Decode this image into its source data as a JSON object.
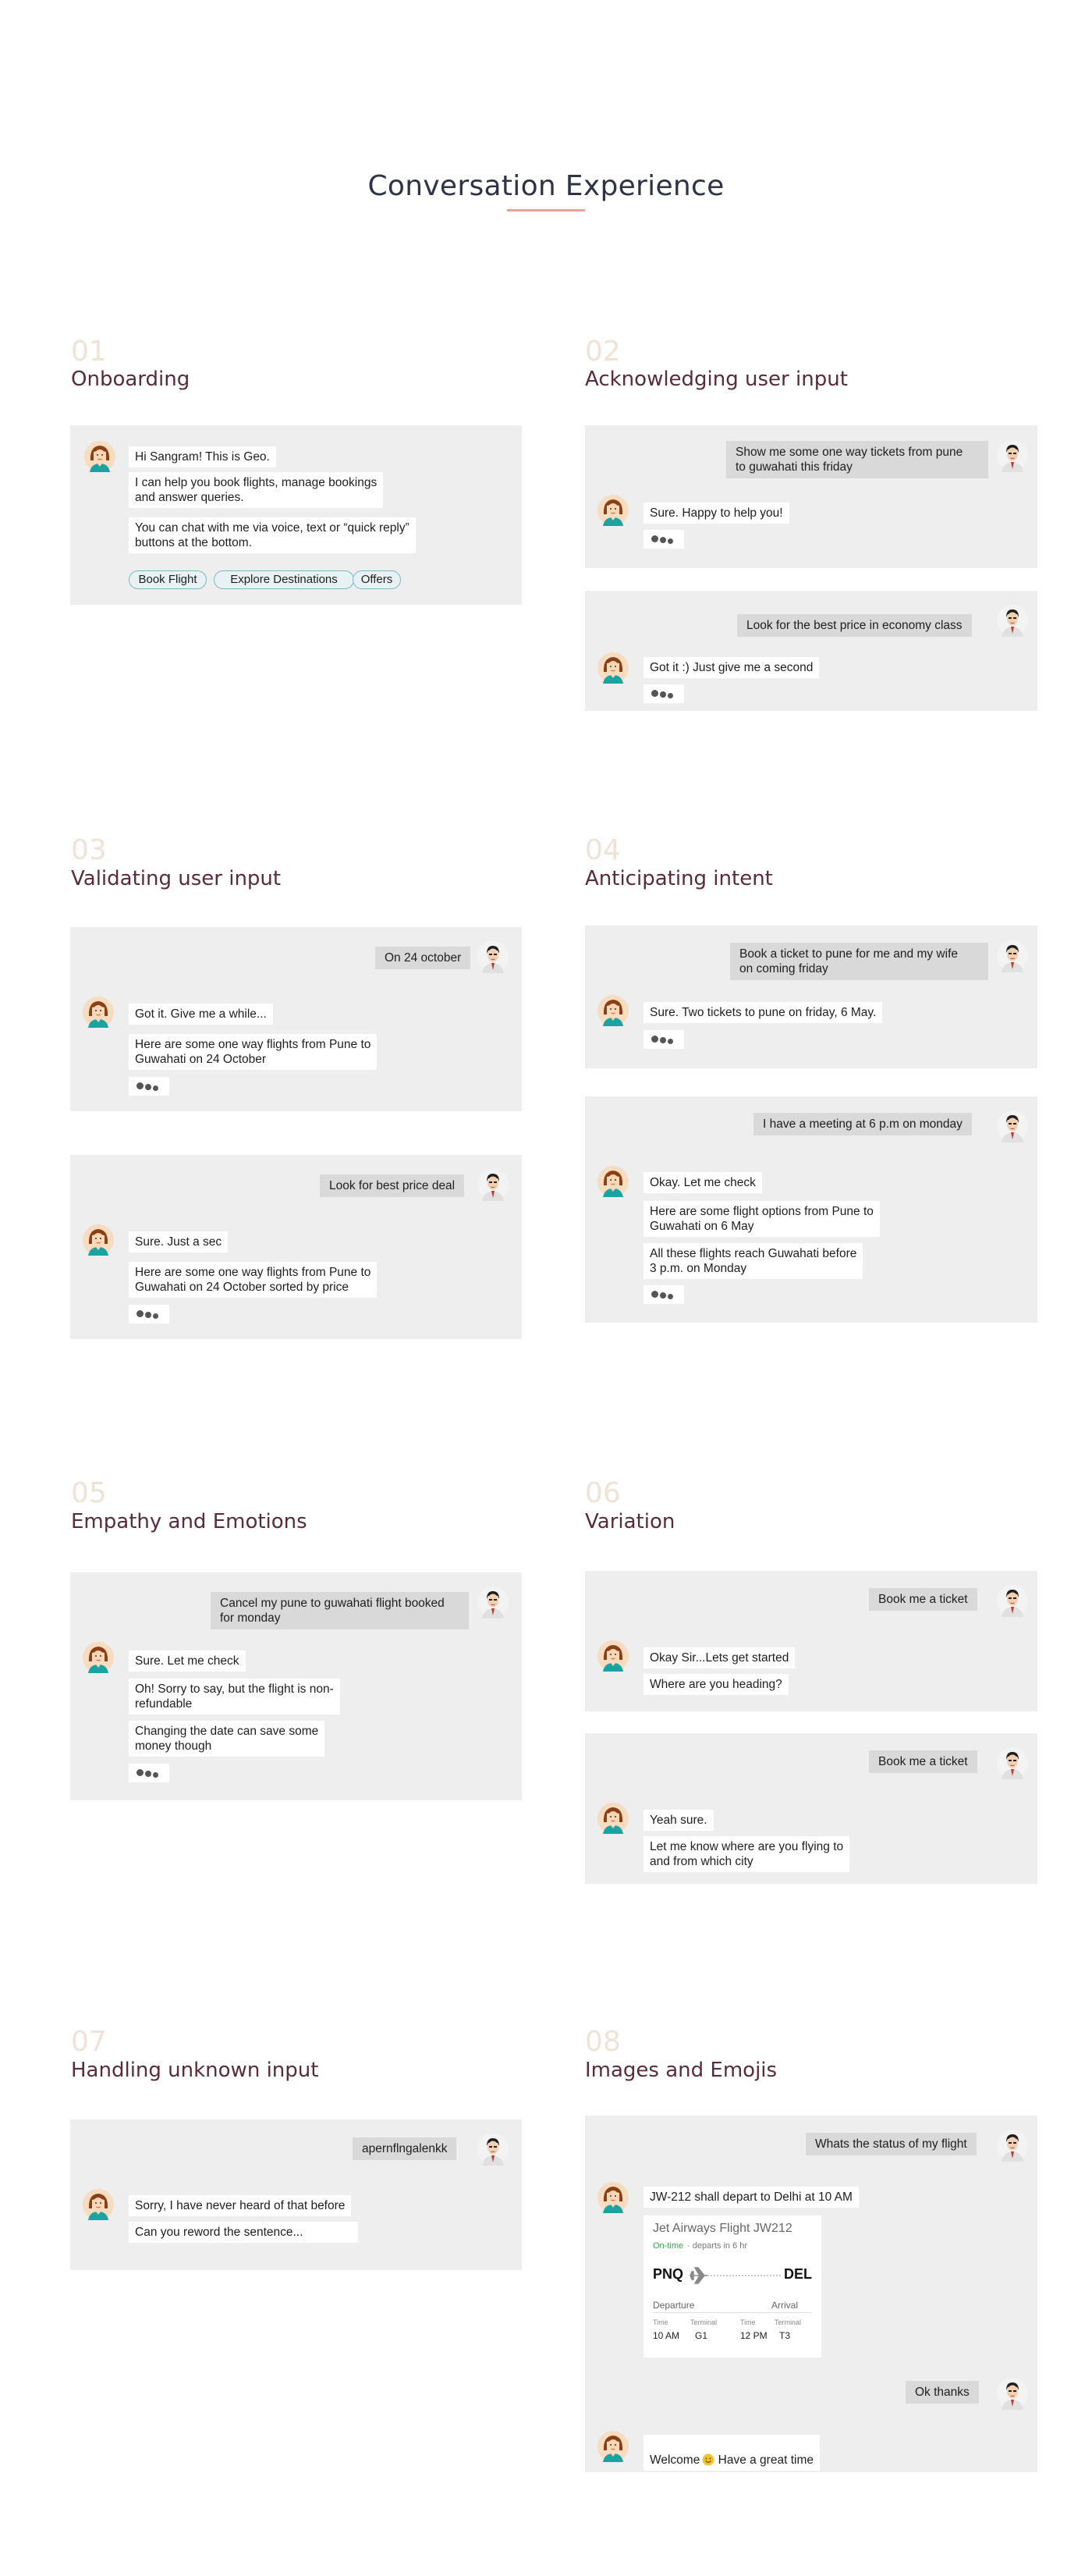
{
  "page": {
    "title": "Conversation Experience"
  },
  "colors": {
    "panel": "#eeeeee",
    "user_bubble": "#d9d9d9",
    "bot_bubble": "#ffffff",
    "section_title": "#5a2b38",
    "section_number": "#f0e2d4",
    "chip_border": "#7fb6c2",
    "ontime_green": "#36a852"
  },
  "icons": {
    "bot_avatar": "woman-avatar-icon",
    "user_avatar": "man-avatar-icon",
    "typing": "typing-dots-icon",
    "plane": "plane-icon",
    "emoji": "smiley-emoji-icon"
  },
  "sections": {
    "s01": {
      "num": "01",
      "title": "Onboarding",
      "bot": [
        "Hi Sangram! This is Geo.",
        "I can help you book flights, manage bookings\nand answer queries.",
        "You can chat with me via voice, text or “quick reply”\nbuttons at the bottom."
      ],
      "chips": [
        "Book Flight",
        "Explore Destinations",
        "Offers"
      ]
    },
    "s02": {
      "num": "02",
      "title": "Acknowledging user input",
      "c1_user": "Show me some one way tickets from pune\nto guwahati this friday",
      "c1_bot": "Sure. Happy to help you!",
      "c2_user": "Look for the best price in economy class",
      "c2_bot": "Got it :) Just give me a second"
    },
    "s03": {
      "num": "03",
      "title": "Validating user input",
      "c1_user": "On 24 october",
      "c1_bot": [
        "Got it. Give me a while...",
        "Here are some one way flights from Pune to\nGuwahati on 24 October"
      ],
      "c2_user": "Look for best price deal",
      "c2_bot": [
        "Sure. Just a sec",
        "Here are some one way flights from Pune to\nGuwahati on 24 October sorted by price"
      ]
    },
    "s04": {
      "num": "04",
      "title": "Anticipating intent",
      "c1_user": "Book a ticket to pune for me and my wife\non coming friday",
      "c1_bot": "Sure. Two tickets to pune on friday, 6 May.",
      "c2_user": "I have a meeting at 6 p.m on monday",
      "c2_bot": [
        "Okay. Let me check",
        "Here are some flight options from Pune to\nGuwahati on 6 May",
        "All these flights reach Guwahati before\n3 p.m. on Monday"
      ]
    },
    "s05": {
      "num": "05",
      "title": "Empathy and Emotions",
      "user": "Cancel my pune to guwahati flight booked\nfor monday",
      "bot": [
        "Sure. Let me check",
        "Oh! Sorry to say, but the flight is non-\nrefundable",
        "Changing the date can save some\nmoney though"
      ]
    },
    "s06": {
      "num": "06",
      "title": "Variation",
      "c1_user": "Book me a ticket",
      "c1_bot": [
        "Okay Sir...Lets get started",
        "Where are you heading?"
      ],
      "c2_user": "Book me a ticket",
      "c2_bot": [
        "Yeah sure.",
        "Let me know where are you flying to\nand from which city"
      ]
    },
    "s07": {
      "num": "07",
      "title": "Handling unknown input",
      "user": "apernflngalenkk",
      "bot": [
        "Sorry, I have never heard of that before",
        "Can you reword the sentence..."
      ]
    },
    "s08": {
      "num": "08",
      "title": "Images and Emojis",
      "user1": "Whats the status of my flight",
      "bot1": "JW-212 shall depart to Delhi at 10 AM",
      "flight_card": {
        "title": "Jet Airways Flight JW212",
        "status": "On-time",
        "status_note": "· departs in 6 hr",
        "from": "PNQ",
        "to": "DEL",
        "departure_label": "Departure",
        "arrival_label": "Arrival",
        "time_label": "Time",
        "terminal_label": "Terminal",
        "dep_time": "10 AM",
        "dep_terminal": "G1",
        "arr_time": "12 PM",
        "arr_terminal": "T3"
      },
      "user2": "Ok thanks",
      "bot2_pre": "Welcome",
      "bot2_post": " Have a great time"
    }
  }
}
